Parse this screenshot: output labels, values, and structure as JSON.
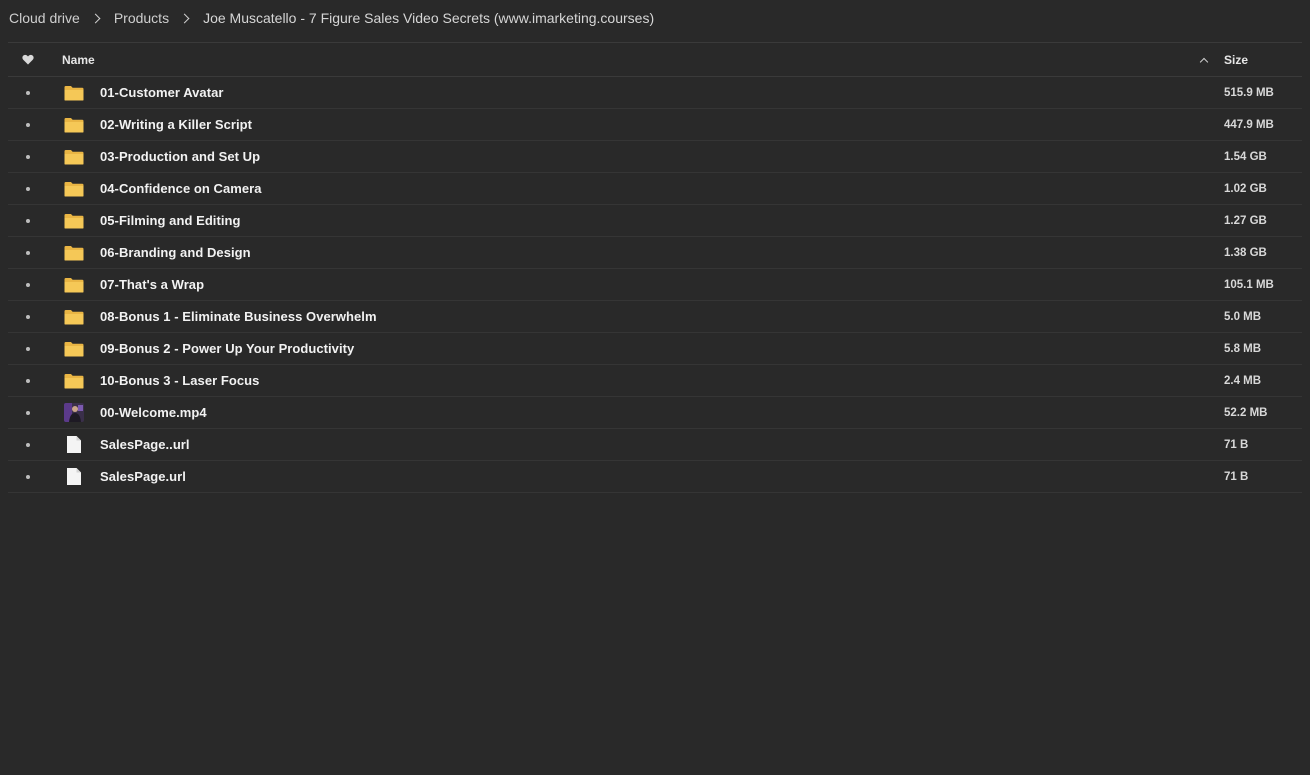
{
  "breadcrumb": {
    "items": [
      "Cloud drive",
      "Products",
      "Joe Muscatello - 7 Figure Sales Video Secrets (www.imarketing.courses)"
    ]
  },
  "table": {
    "columns": {
      "name": "Name",
      "size": "Size"
    },
    "rows": [
      {
        "type": "folder",
        "name": "01-Customer Avatar",
        "size": "515.9 MB"
      },
      {
        "type": "folder",
        "name": "02-Writing a Killer Script",
        "size": "447.9 MB"
      },
      {
        "type": "folder",
        "name": "03-Production and Set Up",
        "size": "1.54 GB"
      },
      {
        "type": "folder",
        "name": "04-Confidence on Camera",
        "size": "1.02 GB"
      },
      {
        "type": "folder",
        "name": "05-Filming and Editing",
        "size": "1.27 GB"
      },
      {
        "type": "folder",
        "name": "06-Branding and Design",
        "size": "1.38 GB"
      },
      {
        "type": "folder",
        "name": "07-That's a Wrap",
        "size": "105.1 MB"
      },
      {
        "type": "folder",
        "name": "08-Bonus 1 - Eliminate Business Overwhelm",
        "size": "5.0 MB"
      },
      {
        "type": "folder",
        "name": "09-Bonus 2 - Power Up Your Productivity",
        "size": "5.8 MB"
      },
      {
        "type": "folder",
        "name": "10-Bonus 3 - Laser Focus",
        "size": "2.4 MB"
      },
      {
        "type": "video",
        "name": "00-Welcome.mp4",
        "size": "52.2 MB"
      },
      {
        "type": "file",
        "name": "SalesPage..url",
        "size": "71 B"
      },
      {
        "type": "file",
        "name": "SalesPage.url",
        "size": "71 B"
      }
    ]
  },
  "colors": {
    "background": "#292929",
    "folder": "#f5c857",
    "folder_tab": "#e9b544",
    "divider": "#353535"
  }
}
